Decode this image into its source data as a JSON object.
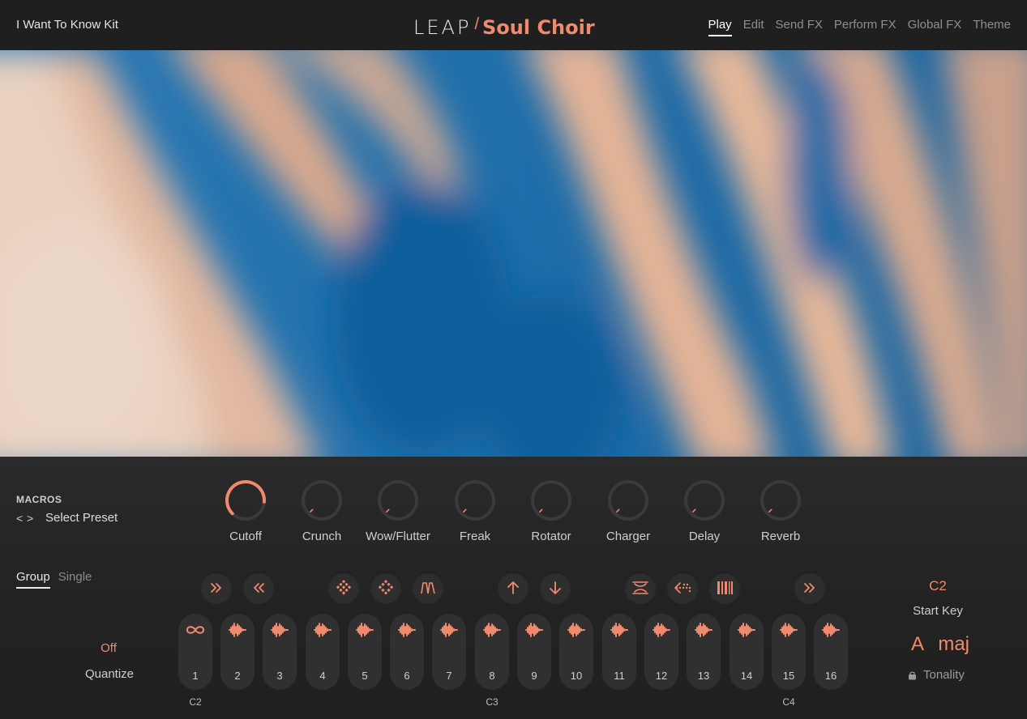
{
  "header": {
    "kit_name": "I Want To Know Kit",
    "logo_left": "LEAP",
    "logo_slash": "/",
    "logo_right": "Soul Choir",
    "tabs": [
      {
        "label": "Play",
        "active": true
      },
      {
        "label": "Edit",
        "active": false
      },
      {
        "label": "Send FX",
        "active": false
      },
      {
        "label": "Perform FX",
        "active": false
      },
      {
        "label": "Global FX",
        "active": false
      },
      {
        "label": "Theme",
        "active": false
      }
    ]
  },
  "macros": {
    "title": "MACROS",
    "prev_arrow": "<",
    "next_arrow": ">",
    "preset": "Select Preset",
    "knobs": [
      {
        "label": "Cutoff",
        "value": 0.85,
        "active": true
      },
      {
        "label": "Crunch",
        "value": 0.0,
        "active": false
      },
      {
        "label": "Wow/Flutter",
        "value": 0.0,
        "active": false
      },
      {
        "label": "Freak",
        "value": 0.0,
        "active": false
      },
      {
        "label": "Rotator",
        "value": 0.0,
        "active": false
      },
      {
        "label": "Charger",
        "value": 0.0,
        "active": false
      },
      {
        "label": "Delay",
        "value": 0.0,
        "active": false
      },
      {
        "label": "Reverb",
        "value": 0.0,
        "active": false
      }
    ]
  },
  "mode": {
    "group": "Group",
    "single": "Single",
    "active": "group"
  },
  "quantize": {
    "value": "Off",
    "label": "Quantize"
  },
  "function_buttons": [
    {
      "icon": "fast-forward-icon"
    },
    {
      "icon": "rewind-icon"
    },
    {
      "icon": "grid-shuffle-icon"
    },
    {
      "icon": "grid-shuffle-alt-icon"
    },
    {
      "icon": "envelope-shape-icon"
    },
    {
      "icon": "arrow-up-icon"
    },
    {
      "icon": "arrow-down-icon"
    },
    {
      "icon": "compress-icon"
    },
    {
      "icon": "reverse-icon"
    },
    {
      "icon": "slices-icon"
    },
    {
      "icon": "fast-forward-icon"
    }
  ],
  "pads": [
    {
      "num": "1",
      "icon": "loop-icon"
    },
    {
      "num": "2",
      "icon": "waveform-icon"
    },
    {
      "num": "3",
      "icon": "waveform-icon"
    },
    {
      "num": "4",
      "icon": "waveform-icon"
    },
    {
      "num": "5",
      "icon": "waveform-icon"
    },
    {
      "num": "6",
      "icon": "waveform-icon"
    },
    {
      "num": "7",
      "icon": "waveform-icon"
    },
    {
      "num": "8",
      "icon": "waveform-icon"
    },
    {
      "num": "9",
      "icon": "waveform-icon"
    },
    {
      "num": "10",
      "icon": "waveform-icon"
    },
    {
      "num": "11",
      "icon": "waveform-icon"
    },
    {
      "num": "12",
      "icon": "waveform-icon"
    },
    {
      "num": "13",
      "icon": "waveform-icon"
    },
    {
      "num": "14",
      "icon": "waveform-icon"
    },
    {
      "num": "15",
      "icon": "waveform-icon"
    },
    {
      "num": "16",
      "icon": "waveform-icon"
    }
  ],
  "octaves": [
    "C2",
    "C3",
    "C4"
  ],
  "start_key": {
    "value": "C2",
    "label": "Start Key"
  },
  "tonality": {
    "value": "A maj",
    "label": "Tonality",
    "icon": "lock-icon"
  },
  "colors": {
    "accent": "#f08a6e",
    "knob_track": "#3a3a3a",
    "background": "#232323",
    "art_blue": "#1a6aa5",
    "art_peach": "#e8b596"
  }
}
